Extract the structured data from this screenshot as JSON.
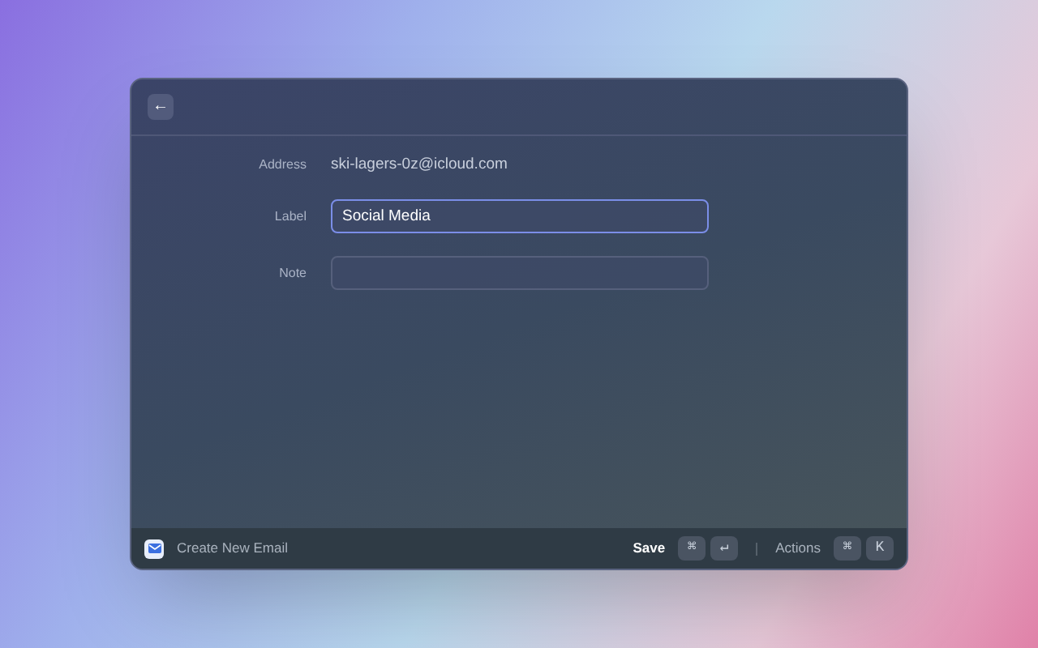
{
  "back_button": {
    "label": "←"
  },
  "fields": [
    {
      "kind": "readonly",
      "label": "Address",
      "value": "ski-lagers-0z@icloud.com"
    },
    {
      "kind": "input",
      "label": "Label",
      "value": "Social Media",
      "focused": true
    },
    {
      "kind": "input",
      "label": "Note",
      "focused": false
    }
  ],
  "footer": {
    "title": "Create New Email",
    "primary_action": {
      "label": "Save",
      "keys": [
        "⌘",
        "↵"
      ]
    },
    "secondary_action": {
      "label": "Actions",
      "keys": [
        "⌘",
        "K"
      ]
    }
  }
}
